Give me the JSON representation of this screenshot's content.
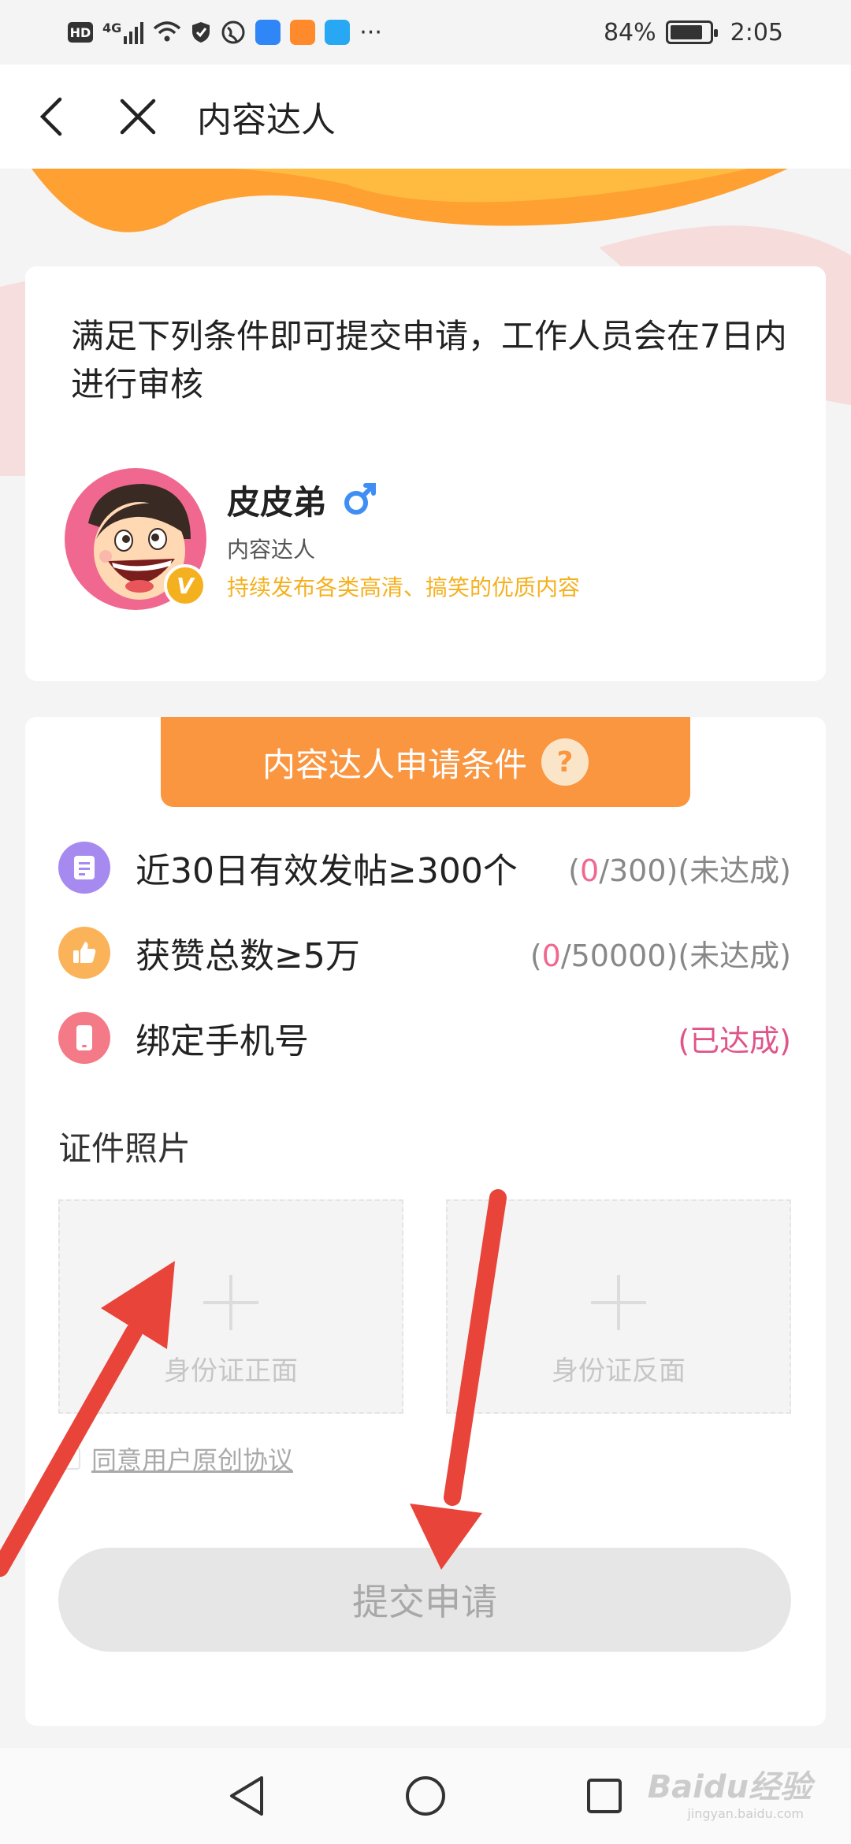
{
  "status_bar": {
    "network_badge": "HD",
    "signal_label": "4G",
    "more": "···",
    "battery_percent": "84%",
    "time": "2:05",
    "battery_level": 0.84
  },
  "header": {
    "title": "内容达人"
  },
  "profile": {
    "intro": "满足下列条件即可提交申请，工作人员会在7日内进行审核",
    "name": "皮皮弟",
    "role": "内容达人",
    "description": "持续发布各类高清、搞笑的优质内容",
    "badge": "V"
  },
  "conditions": {
    "title": "内容达人申请条件",
    "help": "?",
    "items": [
      {
        "label": "近30日有效发帖≥300个",
        "status_open": "(",
        "status_current": "0",
        "status_rest": "/300)(未达成)",
        "icon": "document-icon",
        "color": "#a78af0"
      },
      {
        "label": "获赞总数≥5万",
        "status_open": "(",
        "status_current": "0",
        "status_rest": "/50000)(未达成)",
        "icon": "thumbs-up-icon",
        "color": "#fbb35a"
      },
      {
        "label": "绑定手机号",
        "status": "(已达成)",
        "icon": "phone-icon",
        "color": "#f37a86"
      }
    ]
  },
  "id_photos": {
    "title": "证件照片",
    "front_label": "身份证正面",
    "back_label": "身份证反面"
  },
  "agreement": {
    "link": "同意用户原创协议"
  },
  "submit": {
    "label": "提交申请"
  },
  "watermark": {
    "brand": "Baidu经验",
    "url": "jingyan.baidu.com"
  },
  "colors": {
    "accent": "#fa9540",
    "pink": "#f0688f",
    "gold": "#f5b01f"
  }
}
